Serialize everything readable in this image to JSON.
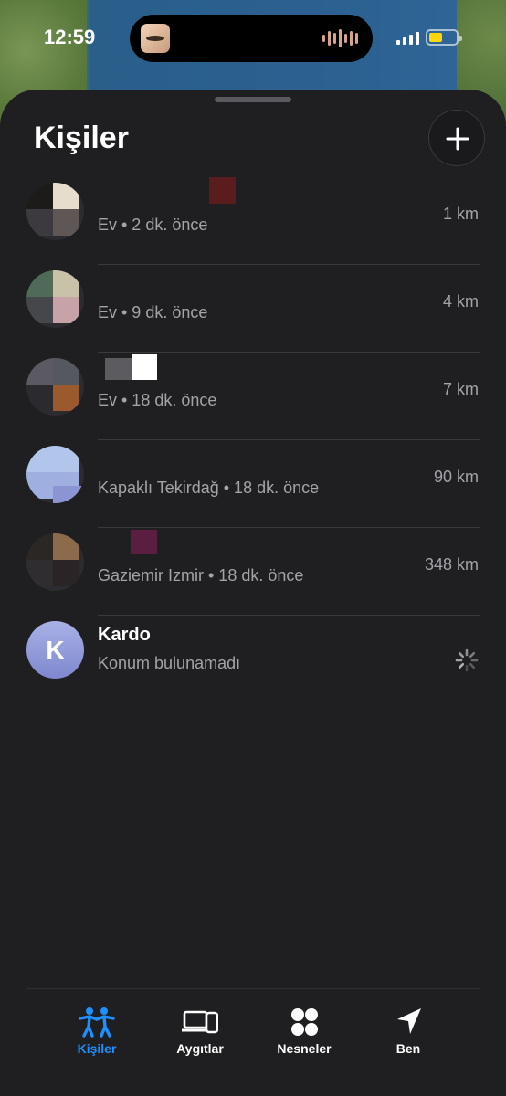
{
  "status_bar": {
    "time": "12:59",
    "battery_color": "#ffd60a"
  },
  "sheet": {
    "title": "Kişiler",
    "add_icon": "plus-icon"
  },
  "people": [
    {
      "name": "",
      "subtitle": "Ev • 2 dk. önce",
      "distance": "1 km"
    },
    {
      "name": "",
      "subtitle": "Ev • 9 dk. önce",
      "distance": "4 km"
    },
    {
      "name": "",
      "subtitle": "Ev • 18 dk. önce",
      "distance": "7 km"
    },
    {
      "name": "",
      "subtitle": "Kapaklı Tekirdağ • 18 dk. önce",
      "distance": "90 km"
    },
    {
      "name": "",
      "subtitle": "Gaziemir Izmir • 18 dk. önce",
      "distance": "348 km"
    },
    {
      "name": "Kardo",
      "initial": "K",
      "subtitle": "Konum bulunamadı",
      "distance": ""
    }
  ],
  "tab_bar": {
    "accent": "#1e8fff",
    "tabs": [
      {
        "label": "Kişiler",
        "icon": "people-icon",
        "active": true
      },
      {
        "label": "Aygıtlar",
        "icon": "devices-icon",
        "active": false
      },
      {
        "label": "Nesneler",
        "icon": "items-icon",
        "active": false
      },
      {
        "label": "Ben",
        "icon": "location-arrow-icon",
        "active": false
      }
    ]
  }
}
